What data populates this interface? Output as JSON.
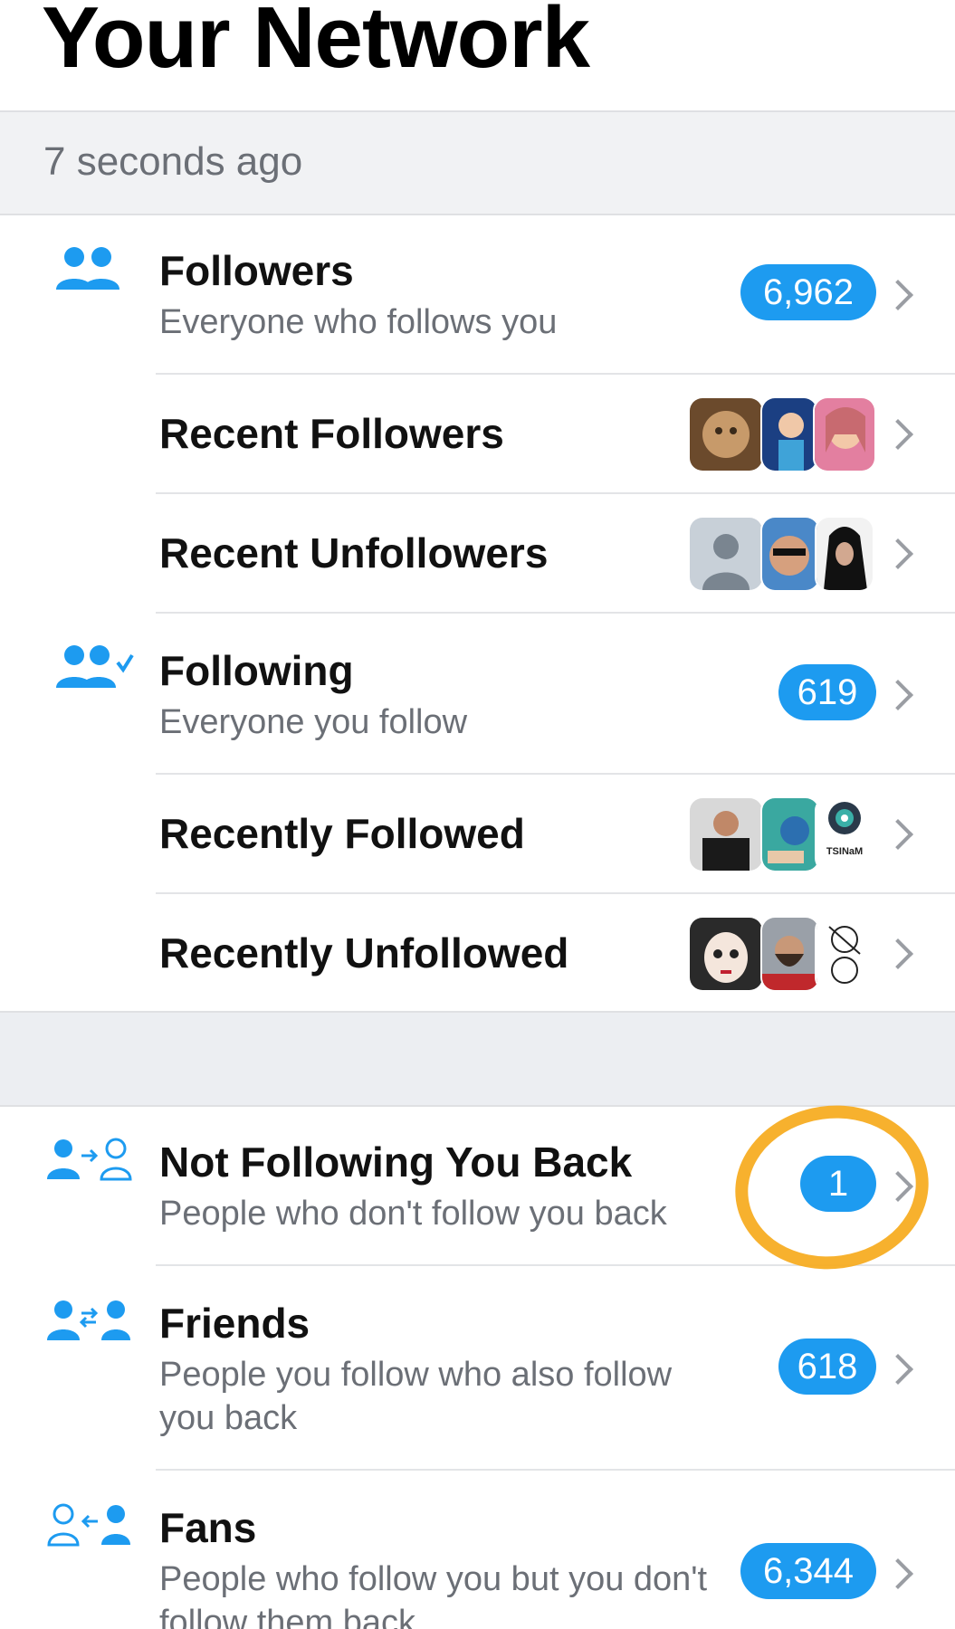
{
  "header": {
    "title": "Your Network"
  },
  "status": {
    "updated": "7 seconds ago"
  },
  "rows": {
    "followers": {
      "label": "Followers",
      "sub": "Everyone who follows you",
      "count": "6,962",
      "icon": "followers-icon"
    },
    "recent_followers": {
      "label": "Recent Followers",
      "thumbs": [
        "sculpture-avatar",
        "cartoon-girl-avatar",
        "woman-avatar"
      ]
    },
    "recent_unfollowers": {
      "label": "Recent Unfollowers",
      "thumbs": [
        "default-avatar",
        "man-sunglasses-avatar",
        "hijab-avatar"
      ]
    },
    "following": {
      "label": "Following",
      "sub": "Everyone you follow",
      "count": "619",
      "icon": "following-icon"
    },
    "recently_followed": {
      "label": "Recently Followed",
      "thumbs": [
        "nike-man-avatar",
        "sky-art-avatar",
        "tsinam-logo-avatar"
      ],
      "thumb_text": "TSINaM"
    },
    "recently_unfollowed": {
      "label": "Recently Unfollowed",
      "thumbs": [
        "clown-face-avatar",
        "bearded-man-avatar",
        "line-drawing-avatar"
      ]
    },
    "not_following_back": {
      "label": "Not Following You Back",
      "sub": "People who don't follow you back",
      "count": "1",
      "icon": "not-following-back-icon"
    },
    "friends": {
      "label": "Friends",
      "sub": "People you follow who also follow you back",
      "count": "618",
      "icon": "friends-icon"
    },
    "fans": {
      "label": "Fans",
      "sub": "People who follow you but you don't follow them back",
      "count": "6,344",
      "icon": "fans-icon"
    }
  },
  "colors": {
    "accent": "#1d9bf0",
    "highlight": "#f6aa1c",
    "muted_text": "#6b6f76",
    "chevron": "#9a9da3"
  }
}
